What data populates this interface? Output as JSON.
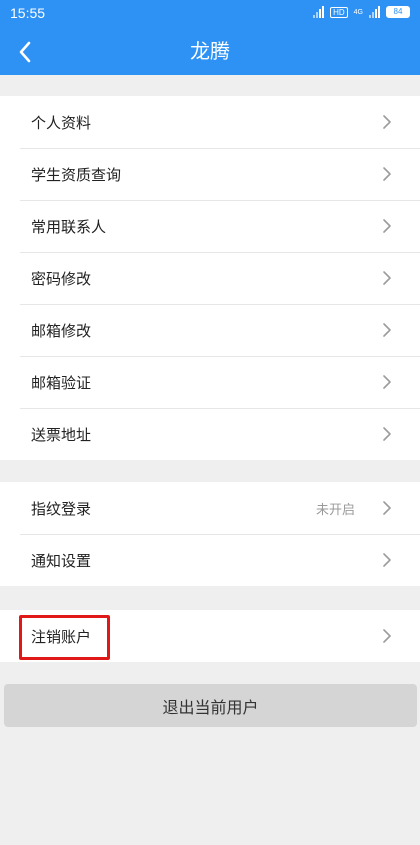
{
  "status_bar": {
    "time": "15:55",
    "hd_label": "HD",
    "network_label": "4G",
    "battery": "84"
  },
  "nav": {
    "title": "龙腾"
  },
  "groups": [
    {
      "items": [
        {
          "label": "个人资料"
        },
        {
          "label": "学生资质查询"
        },
        {
          "label": "常用联系人"
        },
        {
          "label": "密码修改"
        },
        {
          "label": "邮箱修改"
        },
        {
          "label": "邮箱验证"
        },
        {
          "label": "送票地址"
        }
      ]
    },
    {
      "items": [
        {
          "label": "指纹登录",
          "value": "未开启"
        },
        {
          "label": "通知设置"
        }
      ]
    },
    {
      "items": [
        {
          "label": "注销账户",
          "highlighted": true
        }
      ]
    }
  ],
  "logout_label": "退出当前用户",
  "colors": {
    "header": "#2e92f5",
    "background": "#efefef",
    "highlight": "#e01818"
  },
  "icons": {
    "back": "chevron-left-icon",
    "row": "chevron-right-icon"
  }
}
